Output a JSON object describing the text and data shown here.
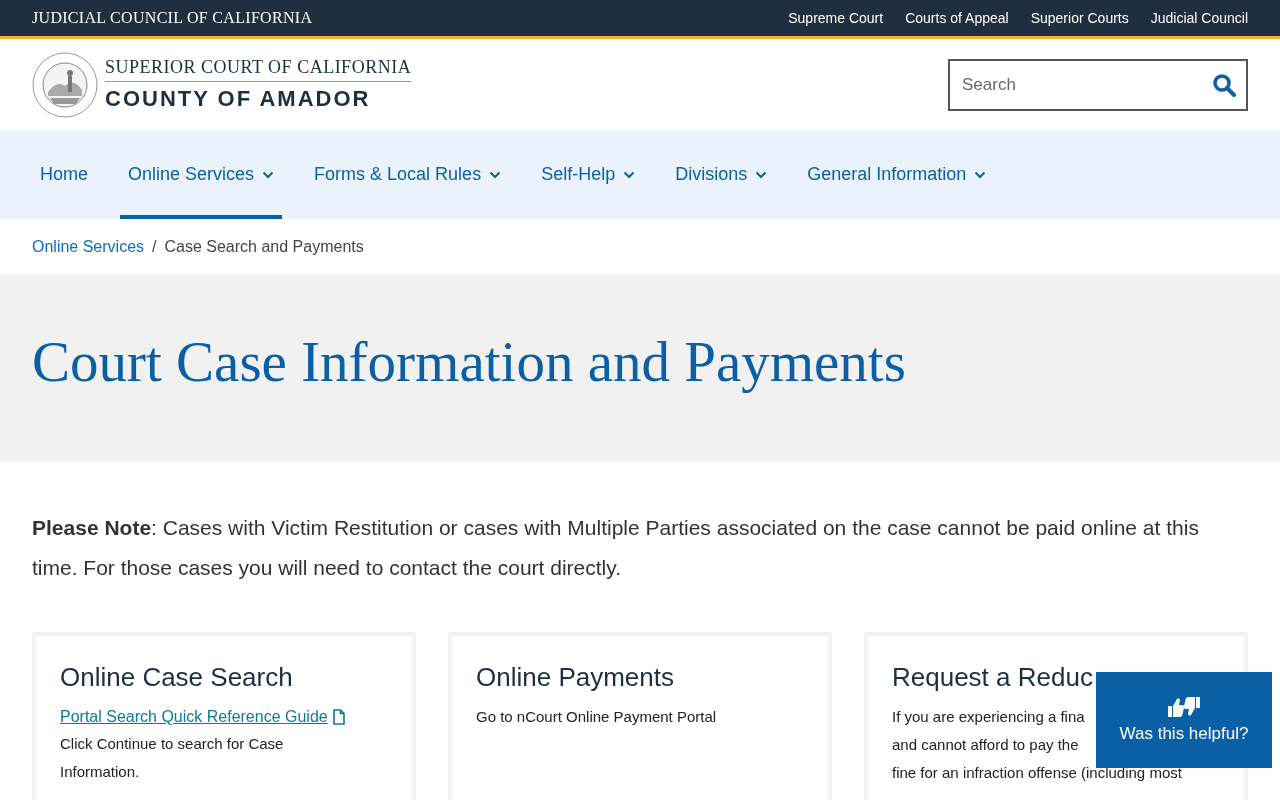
{
  "top_bar": {
    "title": "JUDICIAL COUNCIL OF CALIFORNIA",
    "links": [
      "Supreme Court",
      "Courts of Appeal",
      "Superior Courts",
      "Judicial Council"
    ]
  },
  "header": {
    "court_line": "SUPERIOR COURT OF CALIFORNIA",
    "county_line": "COUNTY OF AMADOR",
    "search": {
      "placeholder": "Search"
    }
  },
  "nav": [
    {
      "label": "Home",
      "dropdown": false,
      "selected": false
    },
    {
      "label": "Online Services",
      "dropdown": true,
      "selected": true
    },
    {
      "label": "Forms & Local Rules",
      "dropdown": true,
      "selected": false
    },
    {
      "label": "Self-Help",
      "dropdown": true,
      "selected": false
    },
    {
      "label": "Divisions",
      "dropdown": true,
      "selected": false
    },
    {
      "label": "General Information",
      "dropdown": true,
      "selected": false
    }
  ],
  "breadcrumb": {
    "link": "Online Services",
    "separator": "/",
    "current": "Case Search and Payments"
  },
  "page_title": "Court Case Information and Payments",
  "note": "**Please Note**: Cases with Victim Restitution or cases with Multiple Parties associated on the case cannot be paid online at this time. For those cases you will need to contact the court directly.",
  "cards": [
    {
      "title": "Online Case Search",
      "link": "Portal Search Quick Reference Guide",
      "lines": [
        "Click Continue to search for Case",
        "Information."
      ]
    },
    {
      "title": "Online Payments",
      "lines": [
        "Go to nCourt Online Payment Portal"
      ]
    },
    {
      "title": "Request a Reduc",
      "lines": [
        "If you are experiencing a fina",
        "and cannot afford to pay the",
        "fine for an infraction offense (including most"
      ]
    }
  ],
  "feedback": {
    "label": "Was this helpful?"
  }
}
